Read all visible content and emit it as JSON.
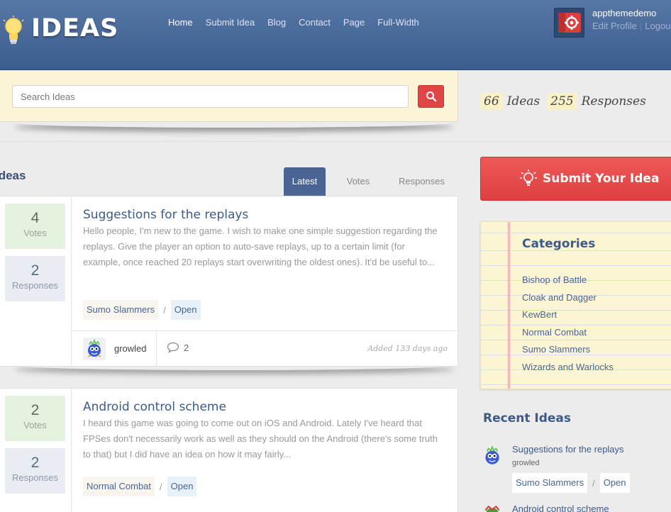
{
  "header": {
    "logo_text": "IDEAS",
    "nav": [
      "Home",
      "Submit Idea",
      "Blog",
      "Contact",
      "Page",
      "Full-Width"
    ],
    "active_nav": "Home",
    "user": {
      "name": "appthemedemo",
      "edit_profile": "Edit Profile",
      "separator": "|",
      "logout": "Logout"
    }
  },
  "search": {
    "placeholder": "Search Ideas",
    "button_icon": "search-icon"
  },
  "stats": {
    "ideas_count": "66",
    "ideas_label": "Ideas",
    "responses_count": "255",
    "responses_label": "Responses"
  },
  "main": {
    "heading": "Ideas",
    "tabs": [
      {
        "label": "Latest",
        "active": true
      },
      {
        "label": "Votes",
        "active": false
      },
      {
        "label": "Responses",
        "active": false
      }
    ],
    "ideas": [
      {
        "votes": "4",
        "votes_label": "Votes",
        "responses": "2",
        "responses_label": "Responses",
        "title": "Suggestions for the replays",
        "excerpt": "Hello people, I'm new to the game. I wish to make one simple suggestion regarding the replays. Give the player an option to auto-save replays, up to a certain limit (for example, once reached 20 replays start overwriting the oldest ones). It'd be useful to...",
        "category": "Sumo Slammers",
        "tag_sep": "/",
        "status": "Open",
        "author": "growled",
        "comments": "2",
        "added": "Added 133 days ago"
      },
      {
        "votes": "2",
        "votes_label": "Votes",
        "responses": "2",
        "responses_label": "Responses",
        "title": "Android control scheme",
        "excerpt": "I heard this game was going to come out on iOS and Android. Lately I've heard that FPSes don't necessarily work as well as they should on the Android (there's some truth to that) but I did have an idea on how it may fairly...",
        "category": "Normal Combat",
        "tag_sep": "/",
        "status": "Open"
      }
    ]
  },
  "sidebar": {
    "submit_button": "Submit Your Idea",
    "categories_title": "Categories",
    "categories": [
      "Bishop of Battle",
      "Cloak and Dagger",
      "KewBert",
      "Normal Combat",
      "Sumo Slammers",
      "Wizards and Warlocks"
    ],
    "recent_title": "Recent Ideas",
    "recent": [
      {
        "title": "Suggestions for the replays",
        "author": "growled",
        "category": "Sumo Slammers",
        "tag_sep": "/",
        "status": "Open"
      },
      {
        "title": "Android control scheme"
      }
    ]
  },
  "colors": {
    "header_blue": "#4a6a9c",
    "accent_red": "#e04545",
    "link_blue": "#3c5a8a",
    "note_yellow": "#fcf5d4"
  }
}
